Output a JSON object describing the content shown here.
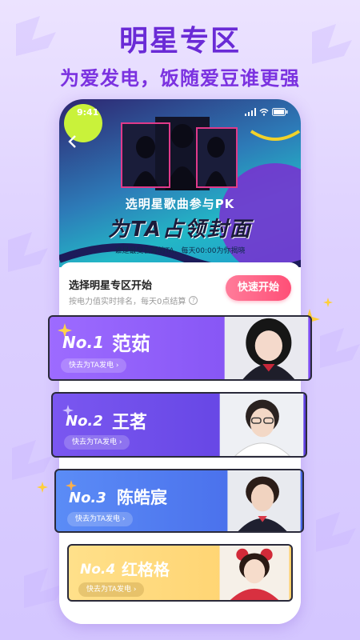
{
  "header": {
    "headline": "明星专区",
    "subline": "为爱发电，饭随爱豆谁更强"
  },
  "phone": {
    "status_time": "9:41",
    "banner": {
      "title": "选明星歌曲参与PK",
      "big": "为TA占领封面",
      "note": "谁是最受喜爱的TA，每天00:00为你揭晓"
    },
    "sheet": {
      "title": "选择明星专区开始",
      "subtitle": "按电力值实时排名，每天0点结算",
      "quick_start": "快速开始"
    },
    "cards": [
      {
        "rank": "No.1",
        "name": "范茹",
        "cta": "快去为TA发电 ›"
      },
      {
        "rank": "No.2",
        "name": "王茗",
        "cta": "快去为TA发电 ›"
      },
      {
        "rank": "No.3",
        "name": "陈皓宸",
        "cta": "快去为TA发电 ›"
      },
      {
        "rank": "No.4",
        "name": "红格格",
        "cta": "快去为TA发电 ›"
      }
    ]
  },
  "colors": {
    "accent": "#6a2bd6",
    "button": "#ff4f77",
    "card1": "#8b5cf6",
    "card2": "#6d4be0",
    "card3": "#4f7bf0",
    "card4": "#ffd77a"
  }
}
